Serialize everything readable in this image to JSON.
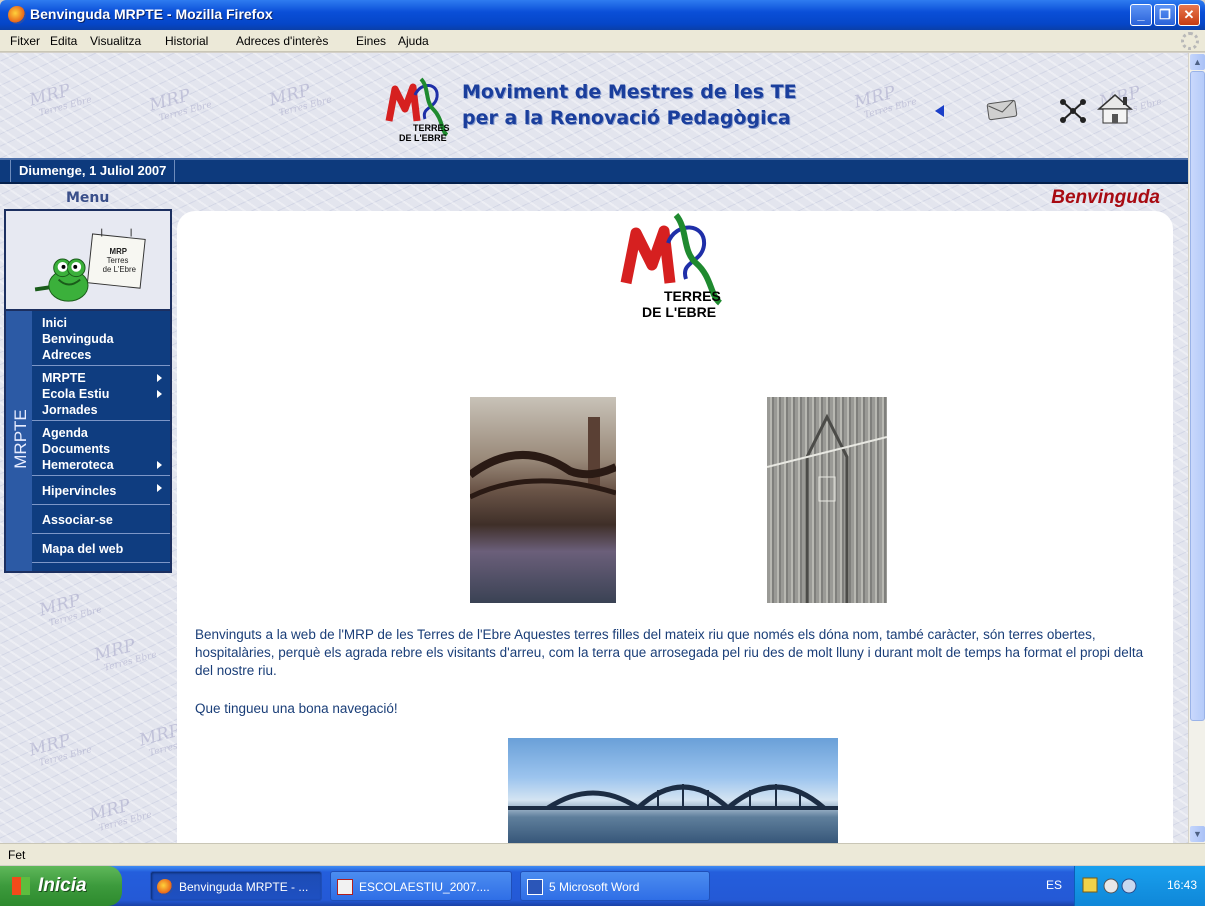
{
  "window": {
    "title": "Benvinguda MRPTE - Mozilla Firefox",
    "controls": [
      "minimize",
      "maximize",
      "close"
    ]
  },
  "menubar": {
    "items": [
      "Fitxer",
      "Edita",
      "Visualitza",
      "Historial",
      "Adreces d'interès",
      "Eines",
      "Ajuda"
    ]
  },
  "header": {
    "logo_text_1": "TERRES",
    "logo_text_2": "DE L'EBRE",
    "title_line1": "Moviment de Mestres de les TE",
    "title_line2": "per a la Renovació Pedagògica",
    "watermark": "MRP",
    "watermark_sub": "Terres Ebre"
  },
  "datebar": {
    "date": "Diumenge, 1 Juliol 2007"
  },
  "side_menu": {
    "label": "Menu",
    "vertical_tab": "MRPTE",
    "sign_text": "MRP Terres de L'Ebre",
    "groups": [
      {
        "items": [
          {
            "label": "Inici"
          },
          {
            "label": "Benvinguda"
          },
          {
            "label": "Adreces"
          }
        ]
      },
      {
        "items": [
          {
            "label": "MRPTE",
            "submenu": true
          },
          {
            "label": "Ecola Estiu",
            "submenu": true
          },
          {
            "label": "Jornades"
          }
        ]
      },
      {
        "items": [
          {
            "label": "Agenda"
          },
          {
            "label": "Documents"
          },
          {
            "label": "Hemeroteca",
            "submenu": true
          }
        ]
      },
      {
        "items": [
          {
            "label": "Hipervincles",
            "submenu": true
          }
        ]
      },
      {
        "items": [
          {
            "label": "Associar-se"
          }
        ]
      },
      {
        "items": [
          {
            "label": "Mapa del web"
          }
        ]
      }
    ]
  },
  "page": {
    "heading": "Benvinguda",
    "intro": "Benvinguts a la web de l'MRP de les Terres de l'Ebre Aquestes terres filles del mateix riu que només els dóna nom, també caràcter, són terres obertes, hospitalàries, perquè els agrada rebre els visitants d'arreu, com la terra que arrosegada pel riu des de molt lluny i durant molt de temps ha format el propi delta del nostre riu.",
    "closing": "Que tingueu una bona navegació!"
  },
  "statusbar": {
    "text": "Fet"
  },
  "taskbar": {
    "start_label": "Inicia",
    "tasks": [
      {
        "label": "Benvinguda MRPTE - ...",
        "icon": "firefox-icon"
      },
      {
        "label": "ESCOLAESTIU_2007....",
        "icon": "pdf-icon"
      },
      {
        "label": "5 Microsoft Word",
        "icon": "word-icon"
      }
    ],
    "language": "ES",
    "clock": "16:43"
  },
  "colors": {
    "title_blue": "#1a3e9c",
    "menu_navy": "#0f3d80",
    "heading_red": "#a80b12",
    "body_text": "#1a3e78"
  }
}
